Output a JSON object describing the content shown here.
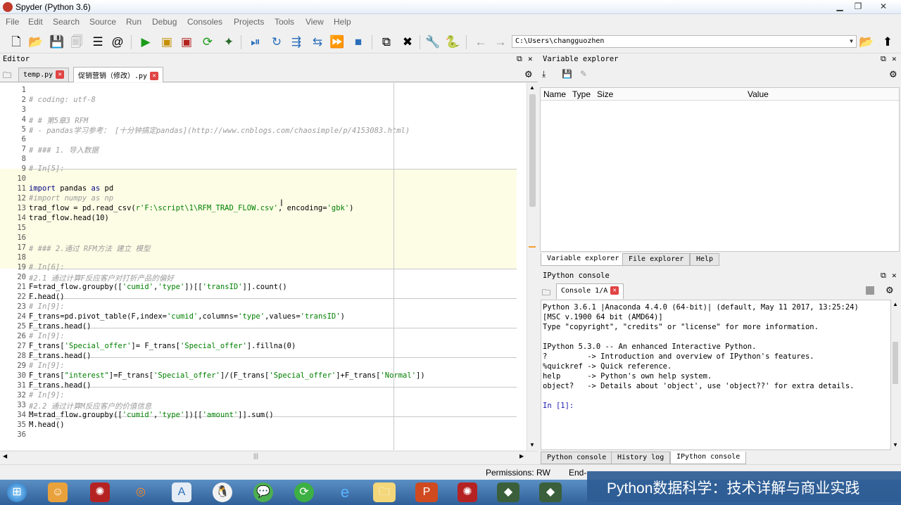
{
  "window": {
    "title": "Spyder (Python 3.6)",
    "minimize": "▁",
    "maximize": "❐",
    "close": "✕"
  },
  "menu": [
    "File",
    "Edit",
    "Search",
    "Source",
    "Run",
    "Debug",
    "Consoles",
    "Projects",
    "Tools",
    "View",
    "Help"
  ],
  "toolbar": {
    "path": "C:\\Users\\changguozhen"
  },
  "editor": {
    "header": "Editor",
    "tabs": [
      {
        "label": "temp.py"
      },
      {
        "label": "促销营销（修改）.py"
      }
    ]
  },
  "code_lines": [
    {
      "n": "1",
      "t": ""
    },
    {
      "n": "2",
      "t": "# coding: utf-8"
    },
    {
      "n": "3",
      "t": ""
    },
    {
      "n": "4",
      "t": "# # 第5章3 RFM"
    },
    {
      "n": "5",
      "t": "# - pandas学习参考： [十分钟搞定pandas](http://www.cnblogs.com/chaosimple/p/4153083.html)"
    },
    {
      "n": "6",
      "t": ""
    },
    {
      "n": "7",
      "t": "# ### 1. 导入数据"
    },
    {
      "n": "8",
      "t": ""
    },
    {
      "n": "9",
      "t": "# In[5]:"
    },
    {
      "n": "10",
      "t": ""
    },
    {
      "n": "11",
      "t": "import pandas as pd"
    },
    {
      "n": "12",
      "t": "#import numpy as np"
    },
    {
      "n": "13",
      "t": "trad_flow = pd.read_csv(r'F:\\script\\1\\RFM_TRAD_FLOW.csv', encoding='gbk')"
    },
    {
      "n": "14",
      "t": "trad_flow.head(10)"
    },
    {
      "n": "15",
      "t": ""
    },
    {
      "n": "16",
      "t": ""
    },
    {
      "n": "17",
      "t": "# ### 2.通过 RFM方法 建立 模型"
    },
    {
      "n": "18",
      "t": ""
    },
    {
      "n": "19",
      "t": "# In[6]:"
    },
    {
      "n": "20",
      "t": "#2.1 通过计算F反应客户对打折产品的偏好"
    },
    {
      "n": "21",
      "t": "F=trad_flow.groupby(['cumid','type'])[['transID']].count()"
    },
    {
      "n": "22",
      "t": "F.head()"
    },
    {
      "n": "23",
      "t": "# In[9]:"
    },
    {
      "n": "24",
      "t": "F_trans=pd.pivot_table(F,index='cumid',columns='type',values='transID')"
    },
    {
      "n": "25",
      "t": "F_trans.head()"
    },
    {
      "n": "26",
      "t": "# In[9]:"
    },
    {
      "n": "27",
      "t": "F_trans['Special_offer']= F_trans['Special_offer'].fillna(0)"
    },
    {
      "n": "28",
      "t": "F_trans.head()"
    },
    {
      "n": "29",
      "t": "# In[9]:"
    },
    {
      "n": "30",
      "t": "F_trans[\"interest\"]=F_trans['Special_offer']/(F_trans['Special_offer']+F_trans['Normal'])"
    },
    {
      "n": "31",
      "t": "F_trans.head()"
    },
    {
      "n": "32",
      "t": "# In[9]:"
    },
    {
      "n": "33",
      "t": "#2.2 通过计算M反应客户的价值信息"
    },
    {
      "n": "34",
      "t": "M=trad_flow.groupby(['cumid','type'])[['amount']].sum()"
    },
    {
      "n": "35",
      "t": "M.head()"
    },
    {
      "n": "36",
      "t": ""
    }
  ],
  "variable_explorer": {
    "header": "Variable explorer",
    "columns": [
      "Name",
      "Type",
      "Size",
      "Value"
    ],
    "tabs": [
      "Variable explorer",
      "File explorer",
      "Help"
    ]
  },
  "ipython": {
    "header": "IPython console",
    "tab": "Console 1/A",
    "lines": [
      "Python 3.6.1 |Anaconda 4.4.0 (64-bit)| (default, May 11 2017, 13:25:24)",
      "[MSC v.1900 64 bit (AMD64)]",
      "Type \"copyright\", \"credits\" or \"license\" for more information.",
      "",
      "IPython 5.3.0 -- An enhanced Interactive Python.",
      "?         -> Introduction and overview of IPython's features.",
      "%quickref -> Quick reference.",
      "help      -> Python's own help system.",
      "object?   -> Details about 'object', use 'object??' for extra details.",
      "",
      "In [1]:"
    ],
    "tabs": [
      "Python console",
      "History log",
      "IPython console"
    ]
  },
  "status": {
    "permissions": "Permissions: RW",
    "eol": "End-"
  },
  "watermark": "Python数据科学：技术详解与商业实践"
}
